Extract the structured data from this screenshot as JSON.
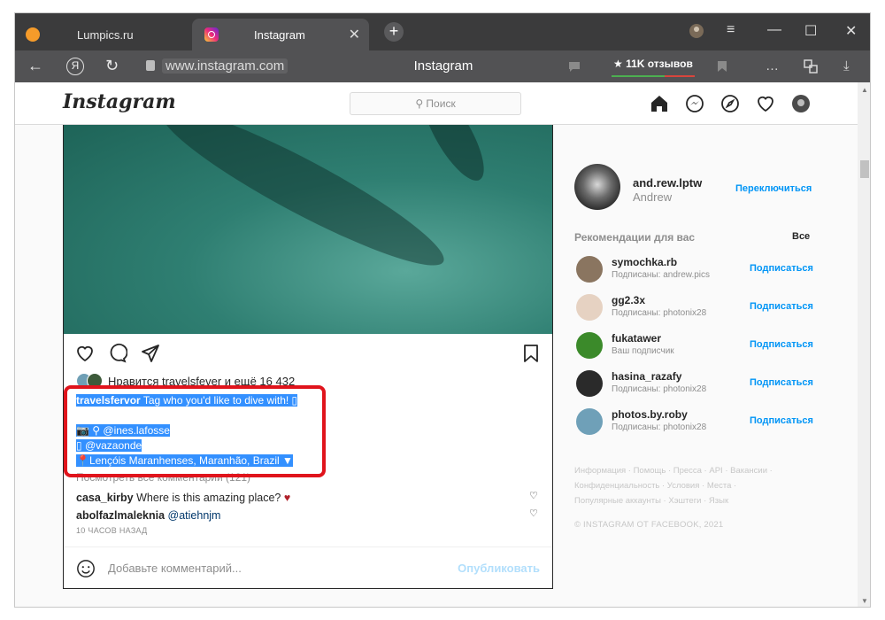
{
  "browser": {
    "tabs": [
      {
        "label": "Lumpics.ru",
        "active": false
      },
      {
        "label": "Instagram",
        "active": true
      }
    ],
    "new_tab": "+",
    "window_controls": {
      "minimize": "—",
      "maximize": "☐",
      "close": "✕",
      "menu": "≡"
    },
    "url": "www.instagram.com",
    "page_title": "Instagram",
    "reviews_badge": "★ 11K отзывов",
    "yandex_label": "Я"
  },
  "ig": {
    "logo": "Instagram",
    "search_placeholder": "⚲ Поиск",
    "post": {
      "likes_text": "Нравится travelsfever и ещё 16 432",
      "caption": {
        "author": "travelsfervor",
        "text": " Tag who you'd like to dive with! ▯",
        "line2": " ",
        "line3": "📷 ⚲ @ines.lafosse",
        "line4": "▯ @vazaonde",
        "line5": "📍Lençóis Maranhenses, Maranhão, Brazil ▼"
      },
      "view_comments": "Посмотреть все комментарии (121)",
      "comments": [
        {
          "user": "casa_kirby",
          "text": " Where is this amazing place? ",
          "emoji": "♥"
        },
        {
          "user": "abolfazlmaleknia",
          "text": " ",
          "mention": "@atiehnjm"
        }
      ],
      "time_ago": "10 ЧАСОВ НАЗАД",
      "comment_placeholder": "Добавьте комментарий...",
      "publish": "Опубликовать"
    },
    "sidebar": {
      "me_username": "and.rew.lptw",
      "me_name": "Andrew",
      "switch": "Переключиться",
      "rec_title": "Рекомендации для вас",
      "rec_all": "Все",
      "recommendations": [
        {
          "user": "symochka.rb",
          "sub": "Подписаны: andrew.pics",
          "follow": "Подписаться",
          "color": "#8a7560"
        },
        {
          "user": "gg2.3x",
          "sub": "Подписаны: photonix28",
          "follow": "Подписаться",
          "color": "#e6d2c2"
        },
        {
          "user": "fukatawer",
          "sub": "Ваш подписчик",
          "follow": "Подписаться",
          "color": "#3b8a2a"
        },
        {
          "user": "hasina_razafy",
          "sub": "Подписаны: photonix28",
          "follow": "Подписаться",
          "color": "#2a2a2a"
        },
        {
          "user": "photos.by.roby",
          "sub": "Подписаны: photonix28",
          "follow": "Подписаться",
          "color": "#6fa0b8"
        }
      ],
      "footer_line1": "Информация · Помощь · Пресса · API · Вакансии ·",
      "footer_line2": "Конфиденциальность · Условия · Места ·",
      "footer_line3": "Популярные аккаунты · Хэштеги · Язык",
      "copyright": "© INSTAGRAM ОТ FACEBOOK, 2021"
    }
  }
}
